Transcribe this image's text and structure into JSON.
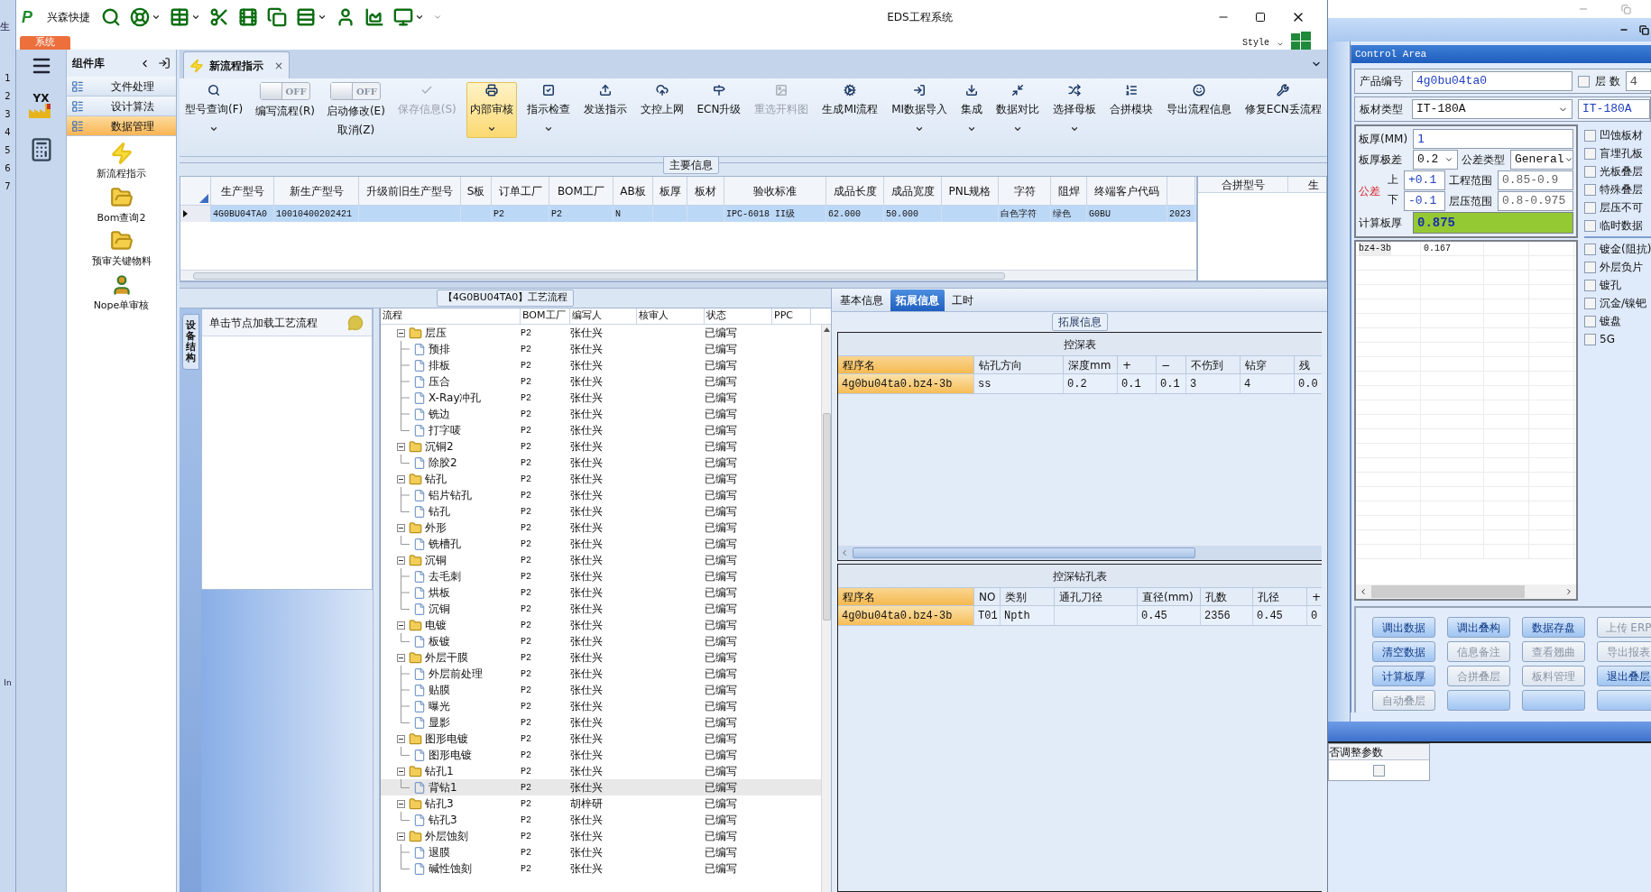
{
  "background_left": {
    "heading": "生",
    "row_numbers": [
      "1",
      "2",
      "3",
      "4",
      "5",
      "6",
      "7"
    ],
    "bottom_label": "In"
  },
  "window": {
    "logo": "P",
    "app_label": "兴森快捷",
    "title": "EDS工程系统",
    "style_label": "Style"
  },
  "quick_toolbar": [
    {
      "has_menu": false
    },
    {
      "has_menu": true
    },
    {
      "has_menu": true
    },
    {
      "has_menu": false
    },
    {
      "has_menu": false
    },
    {
      "has_menu": false
    },
    {
      "has_menu": true
    },
    {
      "has_menu": false
    },
    {
      "has_menu": false
    },
    {
      "has_menu": true
    }
  ],
  "app_tab": "系统",
  "nav_rail": {
    "logo_text": "YX"
  },
  "component_library": {
    "title": "组件库",
    "groups": [
      {
        "label": "文件处理",
        "selected": false
      },
      {
        "label": "设计算法",
        "selected": false
      },
      {
        "label": "数据管理",
        "selected": true
      }
    ],
    "items": [
      "新流程指示",
      "Bom查询2",
      "预审关键物料",
      "Nope单审核"
    ]
  },
  "document_tab": {
    "label": "新流程指示",
    "close": "×"
  },
  "ribbon": [
    {
      "kind": "button",
      "label": "型号查询(F)",
      "disabled": false,
      "selected": false,
      "has_menu": true
    },
    {
      "kind": "toggle",
      "label": "编写流程(R)",
      "switch": "OFF",
      "on": false
    },
    {
      "kind": "toggle",
      "label": "启动修改(E)",
      "sublabel": "取消(Z)",
      "switch": "OFF",
      "on": false
    },
    {
      "kind": "button",
      "label": "保存信息(S)",
      "disabled": true,
      "selected": false,
      "has_menu": false
    },
    {
      "kind": "button",
      "label": "内部审核",
      "disabled": false,
      "selected": true,
      "has_menu": true
    },
    {
      "kind": "button",
      "label": "指示检查",
      "disabled": false,
      "selected": false,
      "has_menu": true
    },
    {
      "kind": "button",
      "label": "发送指示",
      "disabled": false,
      "selected": false,
      "has_menu": false
    },
    {
      "kind": "button",
      "label": "文控上网",
      "disabled": false,
      "selected": false,
      "has_menu": false
    },
    {
      "kind": "button",
      "label": "ECN升级",
      "disabled": false,
      "selected": false,
      "has_menu": false
    },
    {
      "kind": "button",
      "label": "重选开料图",
      "disabled": true,
      "selected": false,
      "has_menu": false
    },
    {
      "kind": "button",
      "label": "生成MI流程",
      "disabled": false,
      "selected": false,
      "has_menu": false
    },
    {
      "kind": "button",
      "label": "MI数据导入",
      "disabled": false,
      "selected": false,
      "has_menu": true
    },
    {
      "kind": "button",
      "label": "集成",
      "disabled": false,
      "selected": false,
      "has_menu": true
    },
    {
      "kind": "button",
      "label": "数据对比",
      "disabled": false,
      "selected": false,
      "has_menu": true
    },
    {
      "kind": "button",
      "label": "选择母板",
      "disabled": false,
      "selected": false,
      "has_menu": true
    },
    {
      "kind": "button",
      "label": "合拼模块",
      "disabled": false,
      "selected": false,
      "has_menu": false
    },
    {
      "kind": "button",
      "label": "导出流程信息",
      "disabled": false,
      "selected": false,
      "has_menu": false
    },
    {
      "kind": "button",
      "label": "修复ECN丢流程",
      "disabled": false,
      "selected": false,
      "has_menu": false
    }
  ],
  "main_info": {
    "title": "主要信息",
    "columns": [
      "生产型号",
      "新生产型号",
      "升级前旧生产型号",
      "S板",
      "订单工厂",
      "BOM工厂",
      "AB板",
      "板厚",
      "板材",
      "验收标准",
      "成品长度",
      "成品宽度",
      "PNL规格",
      "字符",
      "阻焊",
      "终端客户代码"
    ],
    "rows": [
      {
        "selected": true,
        "cells": [
          "4G0BU04TA0",
          "10010400202421",
          null,
          null,
          "P2",
          "P2",
          "N",
          null,
          null,
          "IPC-6018 II级",
          "62.000",
          "50.000",
          null,
          "白色字符",
          "绿色",
          "G0BU",
          "2023"
        ]
      }
    ],
    "side_columns": [
      "合拼型号",
      "生"
    ]
  },
  "process_pane": {
    "title": "【4G0BU04TA0】工艺流程",
    "side_tab": "设备结构",
    "hint": "单击节点加载工艺流程",
    "columns": [
      "流程",
      "BOM工厂",
      "编写人",
      "核审人",
      "状态",
      "PPC"
    ],
    "tree": [
      {
        "name": "层压",
        "bom": "P2",
        "writer": "张仕兴",
        "status": "已编写",
        "selected": false,
        "expanded": true,
        "children": [
          {
            "name": "预排",
            "bom": "P2",
            "writer": "张仕兴",
            "status": "已编写",
            "selected": false
          },
          {
            "name": "排板",
            "bom": "P2",
            "writer": "张仕兴",
            "status": "已编写",
            "selected": false
          },
          {
            "name": "压合",
            "bom": "P2",
            "writer": "张仕兴",
            "status": "已编写",
            "selected": false
          },
          {
            "name": "X-Ray冲孔",
            "bom": "P2",
            "writer": "张仕兴",
            "status": "已编写",
            "selected": false
          },
          {
            "name": "铣边",
            "bom": "P2",
            "writer": "张仕兴",
            "status": "已编写",
            "selected": false
          },
          {
            "name": "打字唛",
            "bom": "P2",
            "writer": "张仕兴",
            "status": "已编写",
            "selected": false
          }
        ]
      },
      {
        "name": "沉铜2",
        "bom": "P2",
        "writer": "张仕兴",
        "status": "已编写",
        "selected": false,
        "expanded": true,
        "children": [
          {
            "name": "除胶2",
            "bom": "P2",
            "writer": "张仕兴",
            "status": "已编写",
            "selected": false
          }
        ]
      },
      {
        "name": "钻孔",
        "bom": "P2",
        "writer": "张仕兴",
        "status": "已编写",
        "selected": false,
        "expanded": true,
        "children": [
          {
            "name": "铝片钻孔",
            "bom": "P2",
            "writer": "张仕兴",
            "status": "已编写",
            "selected": false
          },
          {
            "name": "钻孔",
            "bom": "P2",
            "writer": "张仕兴",
            "status": "已编写",
            "selected": false
          }
        ]
      },
      {
        "name": "外形",
        "bom": "P2",
        "writer": "张仕兴",
        "status": "已编写",
        "selected": false,
        "expanded": true,
        "children": [
          {
            "name": "铣槽孔",
            "bom": "P2",
            "writer": "张仕兴",
            "status": "已编写",
            "selected": false
          }
        ]
      },
      {
        "name": "沉铜",
        "bom": "P2",
        "writer": "张仕兴",
        "status": "已编写",
        "selected": false,
        "expanded": true,
        "children": [
          {
            "name": "去毛刺",
            "bom": "P2",
            "writer": "张仕兴",
            "status": "已编写",
            "selected": false
          },
          {
            "name": "烘板",
            "bom": "P2",
            "writer": "张仕兴",
            "status": "已编写",
            "selected": false
          },
          {
            "name": "沉铜",
            "bom": "P2",
            "writer": "张仕兴",
            "status": "已编写",
            "selected": false
          }
        ]
      },
      {
        "name": "电镀",
        "bom": "P2",
        "writer": "张仕兴",
        "status": "已编写",
        "selected": false,
        "expanded": true,
        "children": [
          {
            "name": "板镀",
            "bom": "P2",
            "writer": "张仕兴",
            "status": "已编写",
            "selected": false
          }
        ]
      },
      {
        "name": "外层干膜",
        "bom": "P2",
        "writer": "张仕兴",
        "status": "已编写",
        "selected": false,
        "expanded": true,
        "children": [
          {
            "name": "外层前处理",
            "bom": "P2",
            "writer": "张仕兴",
            "status": "已编写",
            "selected": false
          },
          {
            "name": "贴膜",
            "bom": "P2",
            "writer": "张仕兴",
            "status": "已编写",
            "selected": false
          },
          {
            "name": "曝光",
            "bom": "P2",
            "writer": "张仕兴",
            "status": "已编写",
            "selected": false
          },
          {
            "name": "显影",
            "bom": "P2",
            "writer": "张仕兴",
            "status": "已编写",
            "selected": false
          }
        ]
      },
      {
        "name": "图形电镀",
        "bom": "P2",
        "writer": "张仕兴",
        "status": "已编写",
        "selected": false,
        "expanded": true,
        "children": [
          {
            "name": "图形电镀",
            "bom": "P2",
            "writer": "张仕兴",
            "status": "已编写",
            "selected": false
          }
        ]
      },
      {
        "name": "钻孔1",
        "bom": "P2",
        "writer": "张仕兴",
        "status": "已编写",
        "selected": false,
        "expanded": true,
        "children": [
          {
            "name": "背钻1",
            "bom": "P2",
            "writer": "张仕兴",
            "status": "已编写",
            "selected": true
          }
        ]
      },
      {
        "name": "钻孔3",
        "bom": "P2",
        "writer": "胡梓研",
        "status": "已编写",
        "selected": false,
        "expanded": true,
        "children": [
          {
            "name": "钻孔3",
            "bom": "P2",
            "writer": "张仕兴",
            "status": "已编写",
            "selected": false
          }
        ]
      },
      {
        "name": "外层蚀刻",
        "bom": "P2",
        "writer": "张仕兴",
        "status": "已编写",
        "selected": false,
        "expanded": true,
        "children": [
          {
            "name": "退膜",
            "bom": "P2",
            "writer": "张仕兴",
            "status": "已编写",
            "selected": false
          },
          {
            "name": "碱性蚀刻",
            "bom": "P2",
            "writer": "张仕兴",
            "status": "已编写",
            "selected": false
          }
        ]
      }
    ]
  },
  "detail_pane": {
    "tabs": [
      {
        "label": "基本信息",
        "selected": false
      },
      {
        "label": "拓展信息",
        "selected": true
      },
      {
        "label": "工时",
        "selected": false
      }
    ],
    "group_title": "拓展信息",
    "depth_table": {
      "title": "控深表",
      "columns": [
        "程序名",
        "钻孔方向",
        "深度mm",
        "+",
        "−",
        "不伤到",
        "钻穿",
        "残"
      ],
      "rows": [
        [
          "4g0bu04ta0.bz4-3b",
          "ss",
          "0.2",
          "0.1",
          "0.1",
          "3",
          "4",
          "0.0"
        ]
      ]
    },
    "depth_drill_table": {
      "title": "控深钻孔表",
      "columns": [
        "程序名",
        "NO",
        "类别",
        "通孔刀径",
        "直径(mm)",
        "孔数",
        "孔径",
        "+"
      ],
      "rows": [
        [
          "4g0bu04ta0.bz4-3b",
          "T01",
          "Npth",
          null,
          "0.45",
          "2356",
          "0.45",
          "0"
        ]
      ]
    }
  },
  "control_area": {
    "title": "Control Area",
    "product_no_label": "产品编号",
    "product_no": "4g0bu04ta0",
    "layers_label": "层 数",
    "layers_checked": false,
    "layers": "4",
    "material_label": "板材类型",
    "material": "IT-180A",
    "material_2": "IT-180A",
    "thickness_label": "板厚(MM)",
    "thickness": "1",
    "thickness_tol_label": "板厚极差",
    "thickness_tol": "0.2",
    "tol_type_label": "公差类型",
    "tol_type": "General",
    "tolerance_label": "公差",
    "upper_label": "上",
    "upper": "+0.1",
    "lower_label": "下",
    "lower": "-0.1",
    "eng_range_label": "工程范围",
    "eng_range": "0.85-0.9",
    "lam_range_label": "层压范围",
    "lam_range": "0.8-0.975",
    "calc_label": "计算板厚",
    "calc": "0.875",
    "grid_rows": [
      [
        "bz4-3b",
        "0.167"
      ]
    ],
    "options": [
      {
        "label": "凹蚀板材",
        "checked": false
      },
      {
        "label": "盲埋孔板",
        "checked": false
      },
      {
        "label": "光板叠层",
        "checked": false
      },
      {
        "label": "特殊叠层",
        "checked": false
      },
      {
        "label": "层压不可",
        "checked": false
      },
      {
        "label": "临时数据",
        "checked": false
      }
    ],
    "options_2": [
      {
        "label": "镀金(阻抗)",
        "checked": false
      },
      {
        "label": "外层负片",
        "checked": false
      },
      {
        "label": "镀孔",
        "checked": false
      },
      {
        "label": "沉金/镍钯",
        "checked": false
      },
      {
        "label": "镀盘",
        "checked": false
      },
      {
        "label": "5G",
        "checked": false
      }
    ],
    "buttons": [
      {
        "kind": "text",
        "label": "调出数据",
        "disabled": false
      },
      {
        "kind": "text",
        "label": "调出叠构",
        "disabled": false
      },
      {
        "kind": "text",
        "label": "数据存盘",
        "disabled": false
      },
      {
        "kind": "text",
        "label": "上传 ERP",
        "disabled": true
      },
      {
        "kind": "text",
        "label": "清空数据",
        "disabled": false
      },
      {
        "kind": "text",
        "label": "信息备注",
        "disabled": true
      },
      {
        "kind": "text",
        "label": "查看翘曲",
        "disabled": true
      },
      {
        "kind": "text",
        "label": "导出报表",
        "disabled": true
      },
      {
        "kind": "text",
        "label": "计算板厚",
        "disabled": false
      },
      {
        "kind": "text",
        "label": "合拼叠层",
        "disabled": true
      },
      {
        "kind": "text",
        "label": "板料管理",
        "disabled": true
      },
      {
        "kind": "text",
        "label": "退出叠层",
        "disabled": false
      },
      {
        "kind": "text",
        "label": "自动叠层",
        "disabled": true
      },
      {
        "kind": "blank",
        "disabled": false
      },
      {
        "kind": "blank",
        "disabled": false
      },
      {
        "kind": "blank",
        "disabled": false
      }
    ]
  },
  "parameter_grid": {
    "column": "否调整参数",
    "checked": false
  }
}
